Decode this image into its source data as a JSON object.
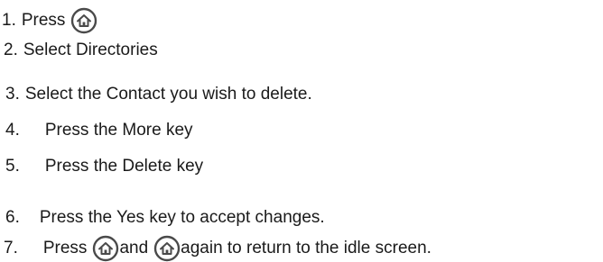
{
  "steps": [
    {
      "number": "1.",
      "text": "Press"
    },
    {
      "number": "2.",
      "text": "Select Directories"
    },
    {
      "number": "3.",
      "text": "Select the Contact you wish to delete."
    },
    {
      "number": "4.",
      "text": "Press the More key"
    },
    {
      "number": "5.",
      "text": "Press the Delete key"
    },
    {
      "number": "6.",
      "text": "Press the Yes key to accept changes."
    },
    {
      "number": "7.",
      "text_before": "Press",
      "text_mid": "and",
      "text_after": "again to return to the idle screen."
    }
  ],
  "icons": {
    "home": "home-icon"
  }
}
